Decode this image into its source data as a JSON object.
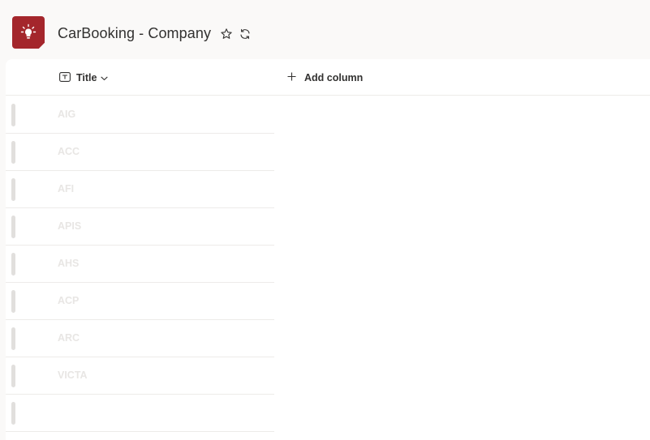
{
  "header": {
    "title": "CarBooking - Company",
    "app_icon": "lightbulb-icon",
    "accent_color": "#a4262c",
    "favorite_icon": "star-icon",
    "sync_icon": "sync-icon"
  },
  "grid": {
    "columns": [
      {
        "label": "Title",
        "icon": "text-field-icon",
        "dropdown_icon": "chevron-down-icon"
      }
    ],
    "add_column_label": "Add column",
    "rows": [
      {
        "title": "AIG"
      },
      {
        "title": "ACC"
      },
      {
        "title": "AFI"
      },
      {
        "title": "APIS"
      },
      {
        "title": "AHS"
      },
      {
        "title": "ACP"
      },
      {
        "title": "ARC"
      },
      {
        "title": "VICTA"
      },
      {
        "title": ""
      }
    ]
  }
}
